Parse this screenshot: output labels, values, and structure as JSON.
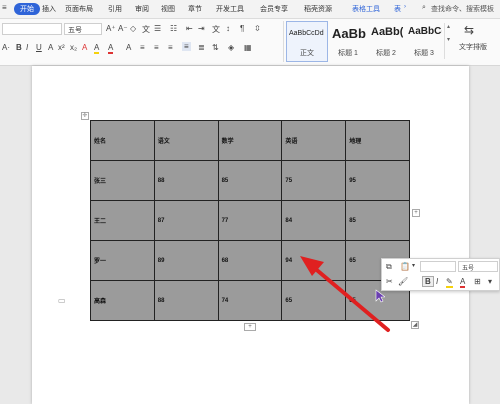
{
  "tabs": [
    "开始",
    "插入",
    "页面布局",
    "引用",
    "审阅",
    "视图",
    "章节",
    "开发工具",
    "会员专享",
    "稻壳资源",
    "表格工具",
    "表",
    "查找命令、搜索模板"
  ],
  "toolbar": {
    "font_name": "",
    "font_size": "五号",
    "styles": [
      {
        "sample": "AaBbCcDd",
        "name": "正文"
      },
      {
        "sample": "AaBb",
        "name": "标题 1"
      },
      {
        "sample": "AaBb(",
        "name": "标题 2"
      },
      {
        "sample": "AaBbC(",
        "name": "标题 3"
      }
    ],
    "text_layout_label": "文字排版"
  },
  "table": {
    "header": [
      "姓名",
      "语文",
      "数学",
      "英语",
      "地理"
    ],
    "rows": [
      [
        "张三",
        "88",
        "85",
        "75",
        "95"
      ],
      [
        "王二",
        "87",
        "77",
        "84",
        "85"
      ],
      [
        "罗一",
        "89",
        "68",
        "94",
        "65"
      ],
      [
        "高森",
        "88",
        "74",
        "65",
        "85"
      ]
    ]
  },
  "float_toolbar": {
    "font_size": "五号"
  },
  "colors": {
    "accent": "#2f64d8",
    "table_fill": "#9b9b9b",
    "arrow": "#e02020"
  }
}
